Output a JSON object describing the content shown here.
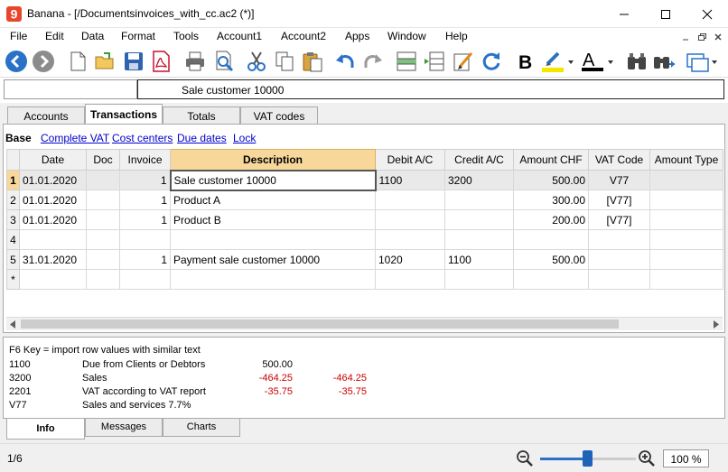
{
  "window": {
    "title": "Banana - [/Documentsinvoices_with_cc.ac2 (*)]",
    "app_icon_glyph": "9",
    "controls": [
      "minimize-icon",
      "maximize-icon",
      "close-icon"
    ]
  },
  "menubar": {
    "items": [
      "File",
      "Edit",
      "Data",
      "Format",
      "Tools",
      "Account1",
      "Account2",
      "Apps",
      "Window",
      "Help"
    ],
    "mdi_controls": [
      "minimize-icon",
      "restore-icon",
      "close-icon"
    ]
  },
  "toolbar": {
    "icons": [
      "back-icon",
      "forward-icon",
      "new-file-icon",
      "open-file-icon",
      "save-icon",
      "pdf-icon",
      "print-icon",
      "print-preview-icon",
      "cut-icon",
      "copy-icon",
      "paste-icon",
      "undo-icon",
      "redo-icon",
      "add-row-icon",
      "insert-row-icon",
      "edit-icon",
      "recheck-icon",
      "bold-icon",
      "highlight-color-icon",
      "text-color-icon",
      "find-icon",
      "find-replace-icon",
      "window-menu-icon"
    ],
    "bold_glyph": "B",
    "text_color_glyph": "A"
  },
  "cellbar": {
    "left_value": "",
    "content": "Sale customer 10000"
  },
  "tabs": [
    {
      "label": "Accounts",
      "active": false
    },
    {
      "label": "Transactions",
      "active": true
    },
    {
      "label": "Totals",
      "active": false
    },
    {
      "label": "VAT codes",
      "active": false
    }
  ],
  "views": [
    "Base",
    "Complete VAT",
    "Cost centers",
    "Due dates",
    "Lock"
  ],
  "grid": {
    "columns": [
      "Date",
      "Doc",
      "Invoice",
      "Description",
      "Debit A/C",
      "Credit A/C",
      "Amount CHF",
      "VAT Code",
      "Amount Type"
    ],
    "rows": [
      {
        "n": "1",
        "date": "01.01.2020",
        "doc": "",
        "invoice": "1",
        "description": "Sale customer 10000",
        "debit": "1100",
        "credit": "3200",
        "amount": "500.00",
        "vat": "V77",
        "amount_type": ""
      },
      {
        "n": "2",
        "date": "01.01.2020",
        "doc": "",
        "invoice": "1",
        "description": "Product A",
        "debit": "",
        "credit": "",
        "amount": "300.00",
        "vat": "[V77]",
        "amount_type": ""
      },
      {
        "n": "3",
        "date": "01.01.2020",
        "doc": "",
        "invoice": "1",
        "description": "Product B",
        "debit": "",
        "credit": "",
        "amount": "200.00",
        "vat": "[V77]",
        "amount_type": ""
      },
      {
        "n": "4",
        "date": "",
        "doc": "",
        "invoice": "",
        "description": "",
        "debit": "",
        "credit": "",
        "amount": "",
        "vat": "",
        "amount_type": ""
      },
      {
        "n": "5",
        "date": "31.01.2020",
        "doc": "",
        "invoice": "1",
        "description": "Payment sale customer 10000",
        "debit": "1020",
        "credit": "1100",
        "amount": "500.00",
        "vat": "",
        "amount_type": ""
      },
      {
        "n": "*",
        "date": "",
        "doc": "",
        "invoice": "",
        "description": "",
        "debit": "",
        "credit": "",
        "amount": "",
        "vat": "",
        "amount_type": ""
      }
    ]
  },
  "info": {
    "hint": "F6 Key = import row values with similar text",
    "lines": [
      {
        "code": "1100",
        "text": "Due from Clients or Debtors",
        "amount1": "500.00",
        "amount2": ""
      },
      {
        "code": "3200",
        "text": "Sales",
        "amount1": "-464.25",
        "amount2": "-464.25"
      },
      {
        "code": "2201",
        "text": "VAT according to VAT report",
        "amount1": "-35.75",
        "amount2": "-35.75"
      },
      {
        "code": "V77",
        "text": "Sales and services 7.7%",
        "amount1": "",
        "amount2": ""
      }
    ]
  },
  "bottom_tabs": [
    {
      "label": "Info",
      "active": true
    },
    {
      "label": "Messages",
      "active": false
    },
    {
      "label": "Charts",
      "active": false
    }
  ],
  "status": {
    "position": "1/6",
    "zoom": "100 %",
    "zoom_level": 0.5
  },
  "colors": {
    "header_highlight": "#f8d89a",
    "negative_amount": "#cc0000",
    "link": "#0000cc",
    "accent_blue": "#2a72c8",
    "app_icon_red": "#e8462c"
  }
}
